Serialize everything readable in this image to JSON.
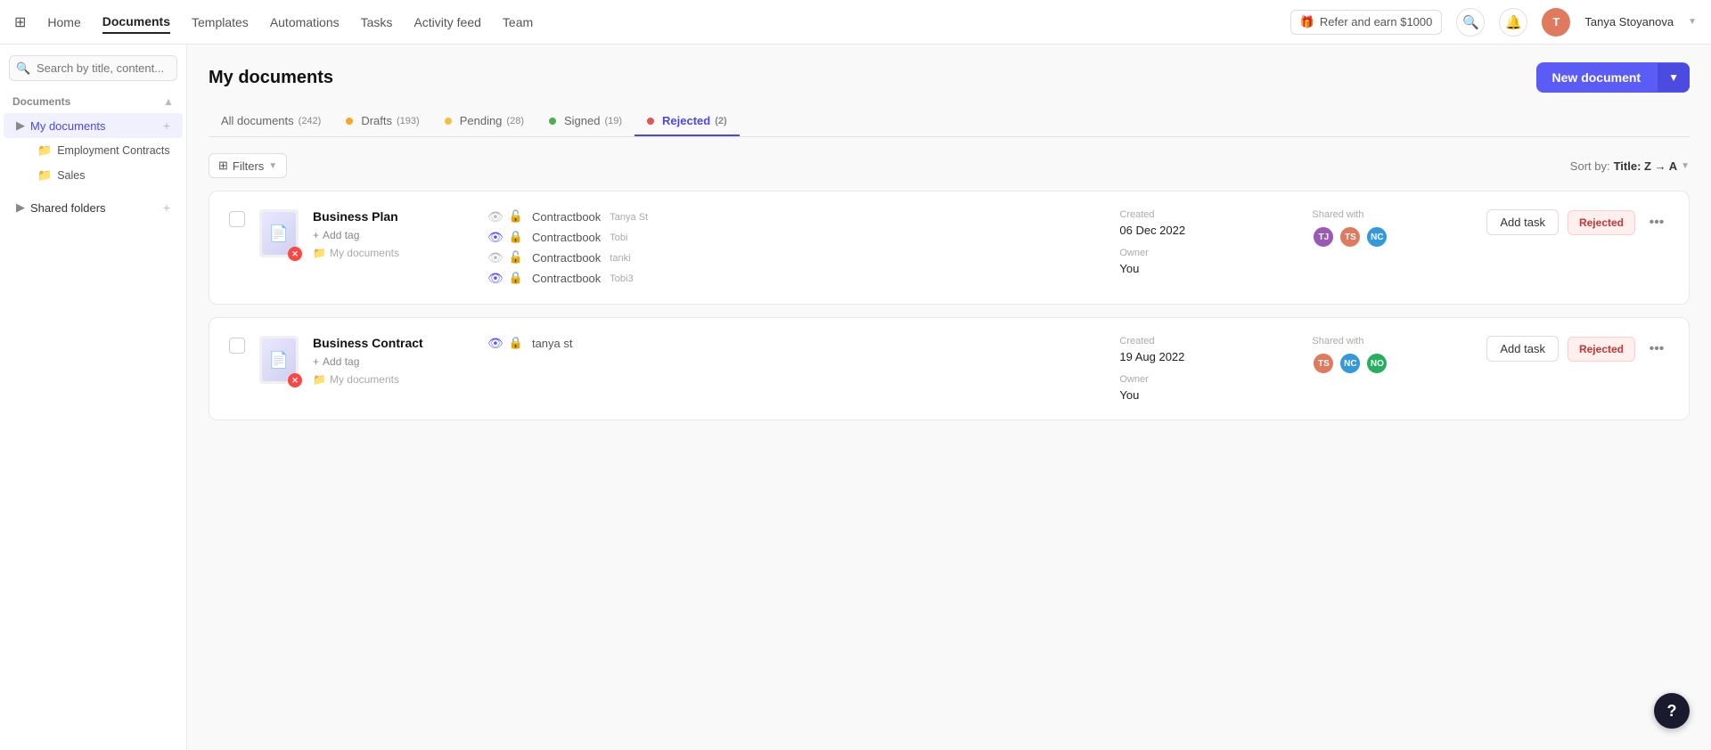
{
  "nav": {
    "home": "Home",
    "documents": "Documents",
    "templates": "Templates",
    "automations": "Automations",
    "tasks": "Tasks",
    "activity_feed": "Activity feed",
    "team": "Team",
    "refer_label": "Refer and earn $1000",
    "user_name": "Tanya Stoyanova",
    "user_initials": "T"
  },
  "sidebar": {
    "search_placeholder": "Search by title, content...",
    "section_label": "Documents",
    "my_documents_label": "My documents",
    "employment_contracts_label": "Employment Contracts",
    "sales_label": "Sales",
    "shared_folders_label": "Shared folders"
  },
  "main": {
    "page_title": "My documents",
    "new_document_label": "New document",
    "filters_label": "Filters",
    "sort_label": "Sort by:",
    "sort_value": "Title: Z → A"
  },
  "tabs": [
    {
      "id": "all",
      "label": "All documents",
      "count": "(242)",
      "dot_color": ""
    },
    {
      "id": "drafts",
      "label": "Drafts",
      "count": "(193)",
      "dot_color": "#f5a623"
    },
    {
      "id": "pending",
      "label": "Pending",
      "count": "(28)",
      "dot_color": "#f0c040"
    },
    {
      "id": "signed",
      "label": "Signed",
      "count": "(19)",
      "dot_color": "#4caf50"
    },
    {
      "id": "rejected",
      "label": "Rejected",
      "count": "(2)",
      "dot_color": "#e05555"
    }
  ],
  "documents": [
    {
      "id": "business-plan",
      "title": "Business Plan",
      "folder": "My documents",
      "tag_label": "Add tag",
      "created_label": "Created",
      "created_value": "06 Dec 2022",
      "owner_label": "Owner",
      "owner_value": "You",
      "shared_with_label": "Shared with",
      "shared_avatars": [
        {
          "initials": "TJ",
          "color": "#9b59b6"
        },
        {
          "initials": "TS",
          "color": "#e07a5f"
        },
        {
          "initials": "NC",
          "color": "#3498db"
        }
      ],
      "add_task_label": "Add task",
      "status": "Rejected",
      "signers": [
        {
          "name": "Contractbook",
          "sub": "Tanya St",
          "eye_active": false,
          "lock_active": false
        },
        {
          "name": "Contractbook",
          "sub": "Tobi",
          "eye_active": true,
          "lock_active": true
        },
        {
          "name": "Contractbook",
          "sub": "tanki",
          "eye_active": false,
          "lock_active": false
        },
        {
          "name": "Contractbook",
          "sub": "Tobi3",
          "eye_active": true,
          "lock_active": true
        }
      ]
    },
    {
      "id": "business-contract",
      "title": "Business Contract",
      "folder": "My documents",
      "tag_label": "Add tag",
      "created_label": "Created",
      "created_value": "19 Aug 2022",
      "owner_label": "Owner",
      "owner_value": "You",
      "shared_with_label": "Shared with",
      "shared_avatars": [
        {
          "initials": "TS",
          "color": "#e07a5f"
        },
        {
          "initials": "NC",
          "color": "#3498db"
        },
        {
          "initials": "NO",
          "color": "#27ae60"
        }
      ],
      "add_task_label": "Add task",
      "status": "Rejected",
      "signers": [
        {
          "name": "tanya st",
          "sub": "",
          "eye_active": true,
          "lock_active": true
        }
      ]
    }
  ],
  "help": "?"
}
